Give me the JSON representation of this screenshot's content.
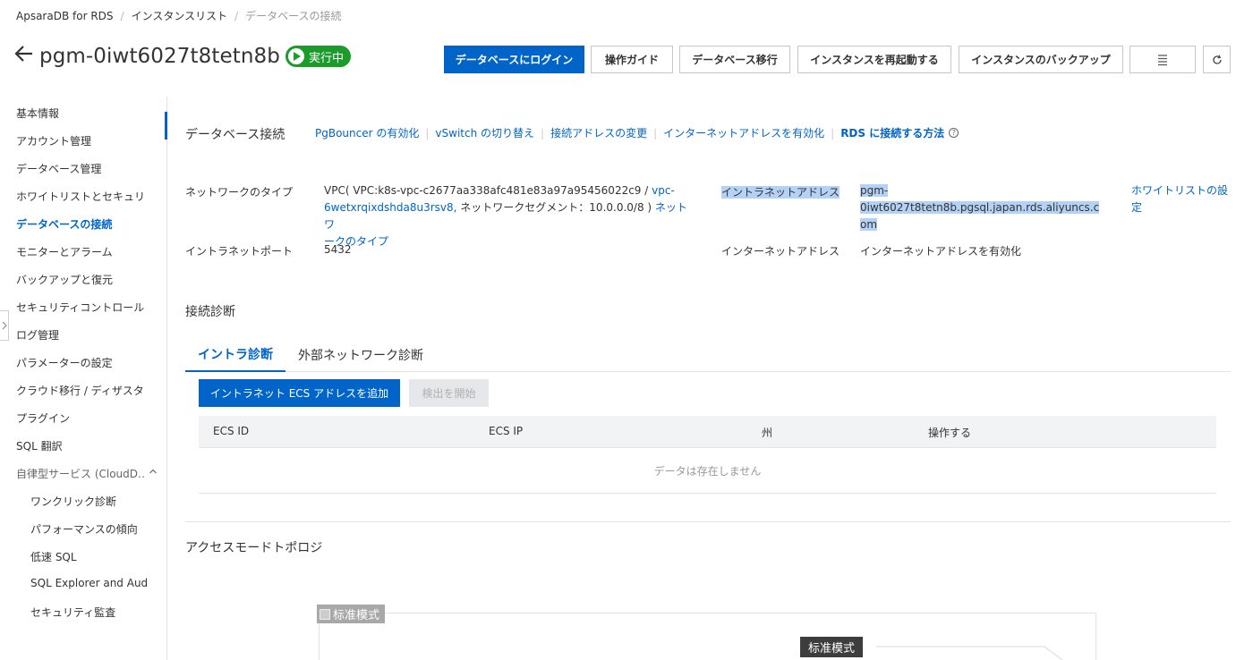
{
  "breadcrumb": [
    "ApsaraDB for RDS",
    "インスタンスリスト",
    "データベースの接続"
  ],
  "header": {
    "title": "pgm-0iwt6027t8tetn8b",
    "status": "実行中",
    "buttons": {
      "login": "データベースにログイン",
      "guide": "操作ガイド",
      "migrate": "データベース移行",
      "restart": "インスタンスを再起動する",
      "backup": "インスタンスのバックアップ"
    }
  },
  "sidebar": {
    "items": [
      "基本情報",
      "アカウント管理",
      "データベース管理",
      "ホワイトリストとセキュリテ",
      "データベースの接続",
      "モニターとアラーム",
      "バックアップと復元",
      "セキュリティコントロール",
      "ログ管理",
      "パラメーターの設定",
      "クラウド移行 / ディザスタ",
      "プラグイン",
      "SQL 翻訳",
      "自律型サービス (CloudD…"
    ],
    "sub_items": [
      "ワンクリック診断",
      "パフォーマンスの傾向",
      "低速 SQL",
      "SQL Explorer and Aud",
      "セキュリティ監査"
    ]
  },
  "db_connection": {
    "title": "データベース接続",
    "links": [
      "PgBouncer の有効化",
      "vSwitch の切り替え",
      "接続アドレスの変更",
      "インターネットアドレスを有効化"
    ],
    "howto": "RDS に接続する方法",
    "network_type_label": "ネットワークのタイプ",
    "network_type_prefix": "VPC( VPC:k8s-vpc-c2677aa338afc481e83a97a95456022c9 / ",
    "vswitch_1": "vpc-",
    "vswitch_2": "6wetxrqixdshda8u3rsv8,",
    "network_segment": " ネットワークセグメント：10.0.0.0/8 ) ",
    "network_type_link_1": "ネットワ",
    "network_type_link_2": "ークのタイプ",
    "intranet_address_label": "イントラネットアドレス",
    "intranet_address_1": "pgm-0iwt6027t8tetn8b.pgsql.japan.rds.aliyuncs.c",
    "intranet_address_2": "om",
    "whitelist_link_1": "ホワイトリストの設",
    "whitelist_link_2": "定",
    "intranet_port_label": "イントラネットポート",
    "intranet_port": "5432",
    "internet_address_label": "インターネットアドレス",
    "internet_address_link": "インターネットアドレスを有効化"
  },
  "diagnosis": {
    "title": "接続診断",
    "tabs": [
      "イントラ診断",
      "外部ネットワーク診断"
    ],
    "add_button": "イントラネット ECS アドレスを追加",
    "start_button": "検出を開始",
    "columns": [
      "ECS ID",
      "ECS IP",
      "州",
      "操作する"
    ],
    "empty": "データは存在しません"
  },
  "topology": {
    "title": "アクセスモードトポロジ",
    "image_alt": "标准模式",
    "mode_tag": "标准模式"
  },
  "colors": {
    "accent": "#0064c8",
    "status_green": "#1a9b2a"
  }
}
